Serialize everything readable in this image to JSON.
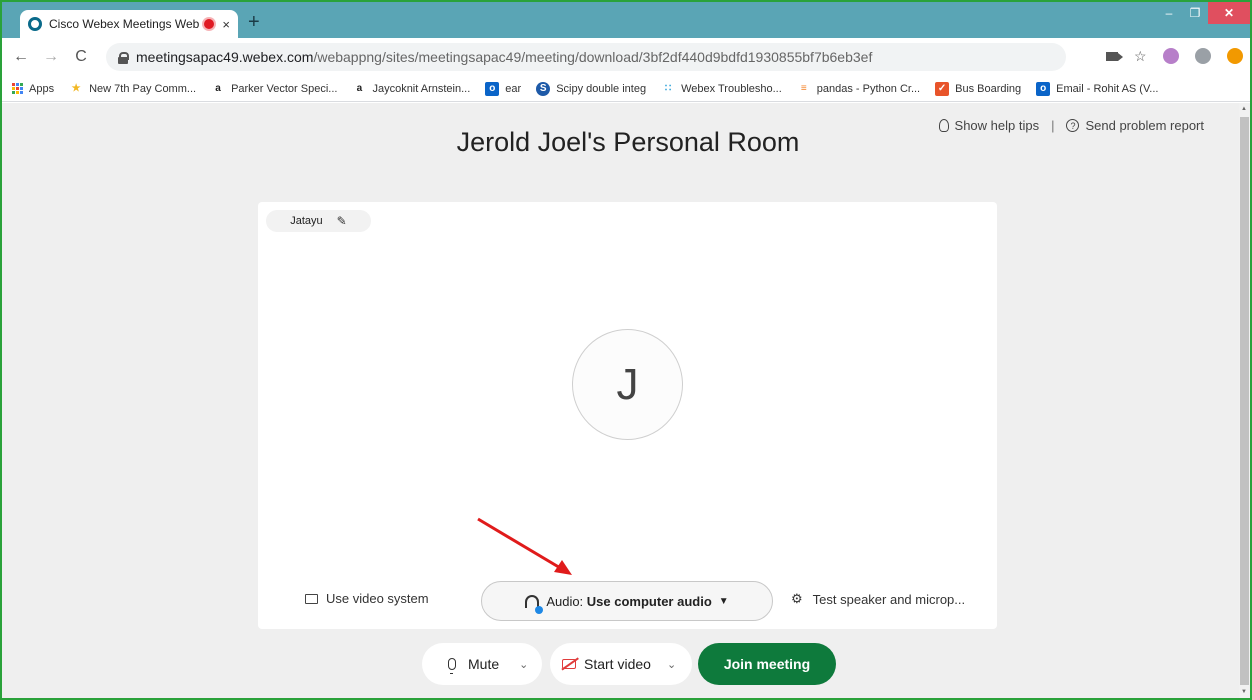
{
  "browser": {
    "tab_title": "Cisco Webex Meetings Web",
    "tab_close": "×",
    "new_tab": "+",
    "window_controls": {
      "minimize": "–",
      "restore": "❐",
      "close": "✕"
    },
    "nav": {
      "back": "←",
      "forward": "→",
      "reload": "C"
    },
    "url_host": "meetingsapac49.webex.com",
    "url_path": "/webappng/sites/meetingsapac49/meeting/download/3bf2df440d9bdfd1930855bf7b6eb3ef",
    "menu": "⋮",
    "star": "☆",
    "extensions": "✱"
  },
  "bookmarks": [
    {
      "label": "Apps",
      "icon": "apps-grid-icon",
      "color": "#4285f4"
    },
    {
      "label": "New 7th Pay Comm...",
      "icon": "7th-pay-icon",
      "glyph": "★",
      "color": "#f2b824"
    },
    {
      "label": "Parker Vector Speci...",
      "icon": "amazon-icon",
      "glyph": "a",
      "color": "#222222"
    },
    {
      "label": "Jaycoknit Arnstein...",
      "icon": "amazon-icon",
      "glyph": "a",
      "color": "#222222"
    },
    {
      "label": "ear",
      "icon": "outlook-icon",
      "glyph": "o",
      "color": "#0a64c8"
    },
    {
      "label": "Scipy double integ",
      "icon": "stackexchange-icon",
      "glyph": "S",
      "color": "#1e5aa8"
    },
    {
      "label": "Webex Troublesho...",
      "icon": "cisco-icon",
      "glyph": "∷",
      "color": "#2aa0d8"
    },
    {
      "label": "pandas - Python Cr...",
      "icon": "stackoverflow-icon",
      "glyph": "≡",
      "color": "#f48024"
    },
    {
      "label": "Bus Boarding",
      "icon": "bus-boarding-icon",
      "glyph": "✓",
      "color": "#e8542a"
    },
    {
      "label": "Email - Rohit AS (V...",
      "icon": "outlook-icon",
      "glyph": "o",
      "color": "#0a64c8"
    }
  ],
  "page": {
    "room_title": "Jerold Joel's Personal Room",
    "help_tips": "Show help tips",
    "separator": "|",
    "send_report": "Send problem report",
    "display_name": "Jatayu",
    "edit_glyph": "✎",
    "avatar_initial": "J",
    "use_video_system": "Use video system",
    "audio_prefix": "Audio: ",
    "audio_value": "Use computer audio",
    "audio_caret": "▼",
    "test_speaker": "Test speaker and microp...",
    "gear_glyph": "⚙"
  },
  "controls": {
    "mute": "Mute",
    "start_video": "Start video",
    "join_meeting": "Join meeting",
    "chevron": "⌄"
  },
  "colors": {
    "accent_green": "#0e7a3c",
    "annotation_arrow": "#e01b1b",
    "tab_strip": "#5aa5b5",
    "window_border": "#2aa23a"
  }
}
